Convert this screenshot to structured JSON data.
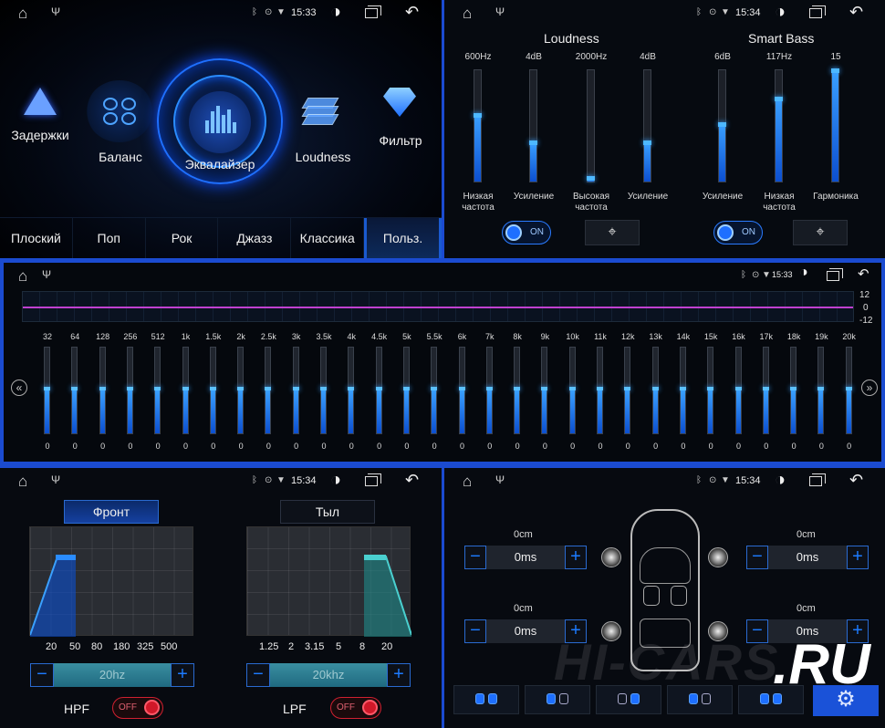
{
  "status": {
    "time1": "15:33",
    "time2": "15:34",
    "time3": "15:33",
    "time4": "15:34",
    "time5": "15:34"
  },
  "modes": {
    "delays": "Задержки",
    "balance": "Баланс",
    "equalizer": "Эквалайзер",
    "loudness": "Loudness",
    "filter": "Фильтр"
  },
  "presets": [
    "Плоский",
    "Поп",
    "Рок",
    "Джазз",
    "Классика",
    "Польз."
  ],
  "loudness_panel": {
    "loudness_title": "Loudness",
    "bass_title": "Smart Bass",
    "sliders": [
      {
        "value": "600Hz",
        "label1": "Низкая",
        "label2": "частота",
        "level": 0.6
      },
      {
        "value": "4dB",
        "label1": "Усиление",
        "label2": "",
        "level": 0.35
      },
      {
        "value": "2000Hz",
        "label1": "Высокая",
        "label2": "частота",
        "level": 0.03
      },
      {
        "value": "4dB",
        "label1": "Усиление",
        "label2": "",
        "level": 0.35
      },
      {
        "value": "6dB",
        "label1": "Усиление",
        "label2": "",
        "level": 0.52
      },
      {
        "value": "117Hz",
        "label1": "Низкая",
        "label2": "частота",
        "level": 0.75
      },
      {
        "value": "15",
        "label1": "Гармоника",
        "label2": "",
        "level": 1.0
      }
    ],
    "toggle_on": "ON"
  },
  "eq": {
    "scale": [
      "12",
      "0",
      "-12"
    ],
    "bands": [
      "32",
      "64",
      "128",
      "256",
      "512",
      "1k",
      "1.5k",
      "2k",
      "2.5k",
      "3k",
      "3.5k",
      "4k",
      "4.5k",
      "5k",
      "5.5k",
      "6k",
      "7k",
      "8k",
      "9k",
      "10k",
      "11k",
      "12k",
      "13k",
      "14k",
      "15k",
      "16k",
      "17k",
      "18k",
      "19k",
      "20k"
    ],
    "values": [
      "0",
      "0",
      "0",
      "0",
      "0",
      "0",
      "0",
      "0",
      "0",
      "0",
      "0",
      "0",
      "0",
      "0",
      "0",
      "0",
      "0",
      "0",
      "0",
      "0",
      "0",
      "0",
      "0",
      "0",
      "0",
      "0",
      "0",
      "0",
      "0",
      "0"
    ]
  },
  "filters": {
    "front": "Фронт",
    "rear": "Тыл",
    "hpf_axis": [
      "20",
      "50",
      "80",
      "180",
      "325",
      "500"
    ],
    "lpf_axis": [
      "1.25",
      "2",
      "3.15",
      "5",
      "8",
      "20"
    ],
    "hpf_value": "20hz",
    "lpf_value": "20khz",
    "hpf": "HPF",
    "lpf": "LPF",
    "off": "OFF"
  },
  "delay": {
    "cm": [
      "0cm",
      "0cm",
      "0cm",
      "0cm"
    ],
    "ms": [
      "0ms",
      "0ms",
      "0ms",
      "0ms"
    ],
    "minus": "−",
    "plus": "+"
  },
  "watermark": {
    "text1": "HI-CARS",
    "text2": ".RU"
  },
  "colors": {
    "accent": "#1e6fff",
    "border": "#1b4bd0",
    "off": "#d01828"
  }
}
